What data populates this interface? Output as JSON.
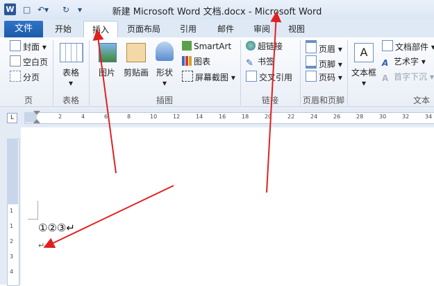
{
  "window": {
    "title": "新建 Microsoft Word 文档.docx - Microsoft Word",
    "app_icon": "W"
  },
  "quick_access": {
    "save_icon": "save-icon",
    "undo_icon": "undo-icon",
    "redo_icon": "redo-icon"
  },
  "tabs": [
    "文件",
    "开始",
    "插入",
    "页面布局",
    "引用",
    "邮件",
    "审阅",
    "视图"
  ],
  "active_tab": "插入",
  "ribbon": {
    "pages": {
      "items": [
        "封面",
        "空白页",
        "分页"
      ],
      "label": "页"
    },
    "tables": {
      "button": "表格",
      "label": "表格"
    },
    "illustrations": {
      "picture": "图片",
      "clipart": "剪贴画",
      "shapes": "形状",
      "smartart": "SmartArt",
      "chart": "图表",
      "screenshot": "屏幕截图",
      "label": "插图"
    },
    "links": {
      "hyperlink": "超链接",
      "bookmark": "书签",
      "crossref": "交叉引用",
      "label": "链接"
    },
    "header_footer": {
      "header": "页眉",
      "footer": "页脚",
      "page_number": "页码",
      "label": "页眉和页脚"
    },
    "text": {
      "textbox": "文本框",
      "quickparts": "文档部件",
      "wordart": "艺术字",
      "dropcap": "首字下沉",
      "label": "文本"
    }
  },
  "ruler": {
    "corner": "L",
    "h_ticks": [
      "2",
      "4",
      "6",
      "8",
      "10",
      "12",
      "14",
      "16",
      "18",
      "20",
      "22",
      "24",
      "26",
      "28",
      "30",
      "32",
      "34"
    ],
    "v_ticks": [
      "1",
      "1",
      "2",
      "3",
      "4"
    ]
  },
  "document": {
    "line1": "①②③↵",
    "line2": "↵"
  },
  "colors": {
    "accent": "#2b579a",
    "file_tab": "#1d5aa8",
    "arrow": "#e02020"
  }
}
